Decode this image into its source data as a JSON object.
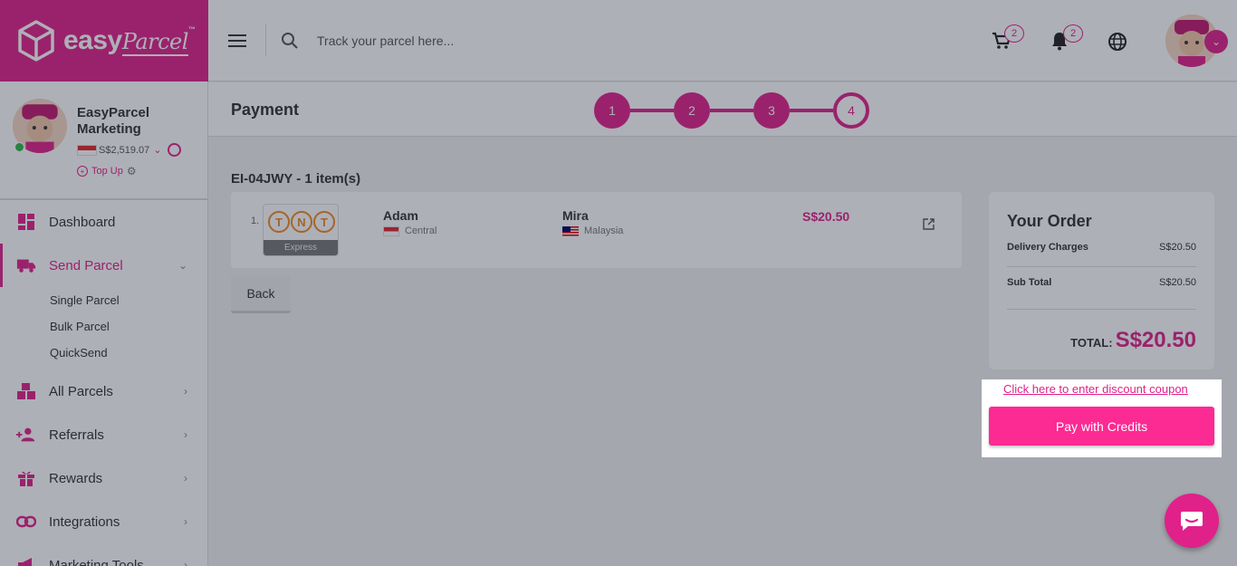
{
  "brand": {
    "name": "easy",
    "script": "Parcel",
    "tm": "™"
  },
  "header": {
    "search_placeholder": "Track your parcel here...",
    "cart_count": "2",
    "notification_count": "2"
  },
  "profile": {
    "name": "EasyParcel Marketing",
    "balance": "S$2,519.07",
    "topup_label": "Top Up",
    "status": "online"
  },
  "sidebar": {
    "items": [
      {
        "label": "Dashboard",
        "icon": "dashboard-icon"
      },
      {
        "label": "Send Parcel",
        "icon": "truck-icon",
        "active": true,
        "submenu": [
          "Single Parcel",
          "Bulk Parcel",
          "QuickSend"
        ]
      },
      {
        "label": "All Parcels",
        "icon": "boxes-icon"
      },
      {
        "label": "Referrals",
        "icon": "user-plus-icon"
      },
      {
        "label": "Rewards",
        "icon": "gift-icon"
      },
      {
        "label": "Integrations",
        "icon": "link-icon"
      },
      {
        "label": "Marketing Tools",
        "icon": "megaphone-icon"
      }
    ]
  },
  "page": {
    "title": "Payment",
    "steps": [
      "1",
      "2",
      "3",
      "4"
    ],
    "current_step": 4
  },
  "order": {
    "id_line": "EI-04JWY - 1 item(s)",
    "parcels": [
      {
        "index": "1.",
        "courier": "TNT",
        "service": "Express",
        "sender_name": "Adam",
        "sender_location": "Central",
        "receiver_name": "Mira",
        "receiver_location": "Malaysia",
        "price": "S$20.50"
      }
    ],
    "back_label": "Back"
  },
  "summary": {
    "title": "Your Order",
    "delivery_label": "Delivery Charges",
    "delivery_value": "S$20.50",
    "subtotal_label": "Sub Total",
    "subtotal_value": "S$20.50",
    "total_label": "TOTAL:",
    "total_value": "S$20.50",
    "coupon_link": "Click here to enter discount coupon",
    "pay_label": "Pay with Credits"
  },
  "colors": {
    "brand": "#e0218a",
    "pay_button": "#fc2a93"
  }
}
